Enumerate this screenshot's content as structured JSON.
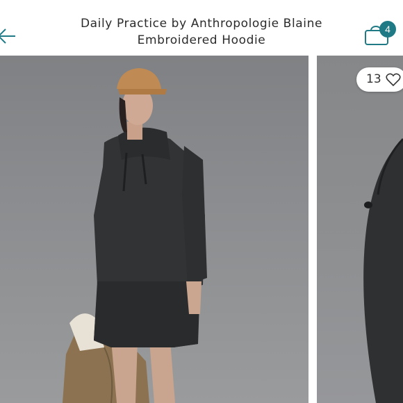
{
  "header": {
    "title_line1": "Daily Practice by Anthropologie Blaine",
    "title_line2": "Embroidered Hoodie",
    "back_icon": "arrow-left-icon",
    "cart_icon": "shopping-bag-icon",
    "cart_count": "4",
    "accent_color": "#1f7a86"
  },
  "gallery": {
    "likes_count": "13",
    "like_icon": "heart-outline-icon"
  }
}
